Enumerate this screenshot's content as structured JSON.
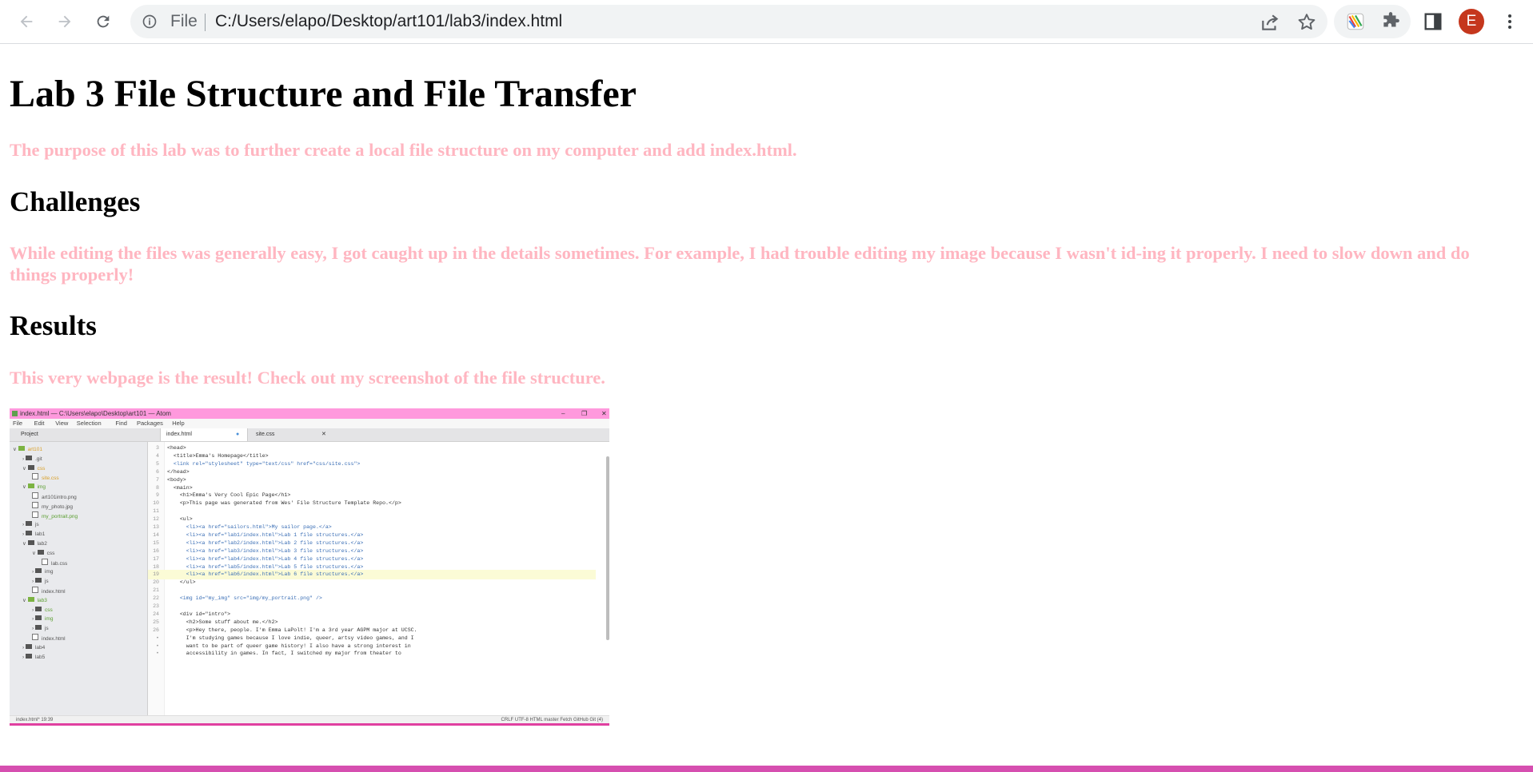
{
  "browser": {
    "file_label": "File",
    "url": "C:/Users/elapo/Desktop/art101/lab3/index.html",
    "avatar_initial": "E"
  },
  "page": {
    "title": "Lab 3 File Structure and File Transfer",
    "intro": "The purpose of this lab was to further create a local file structure on my computer and add index.html.",
    "challenges_heading": "Challenges",
    "challenges_text": "While editing the files was generally easy, I got caught up in the details sometimes. For example, I had trouble editing my image because I wasn't id-ing it properly. I need to slow down and do things properly!",
    "results_heading": "Results",
    "results_text": "This very webpage is the result! Check out my screenshot of the file structure."
  },
  "screenshot": {
    "window_title": "index.html — C:\\Users\\elapo\\Desktop\\art101 — Atom",
    "menu": [
      "File",
      "Edit",
      "View",
      "Selection",
      "Find",
      "Packages",
      "Help"
    ],
    "panel_label": "Project",
    "tabs": [
      "index.html",
      "site.css"
    ],
    "tree": [
      {
        "label": "art101",
        "depth": 0,
        "type": "folder",
        "open": true
      },
      {
        "label": ".git",
        "depth": 1,
        "type": "folder",
        "open": false
      },
      {
        "label": "css",
        "depth": 1,
        "type": "folder",
        "open": true
      },
      {
        "label": "site.css",
        "depth": 2,
        "type": "file"
      },
      {
        "label": "img",
        "depth": 1,
        "type": "folder",
        "open": true
      },
      {
        "label": "art101intro.png",
        "depth": 2,
        "type": "file"
      },
      {
        "label": "my_photo.jpg",
        "depth": 2,
        "type": "file"
      },
      {
        "label": "my_portrait.png",
        "depth": 2,
        "type": "file"
      },
      {
        "label": "js",
        "depth": 1,
        "type": "folder",
        "open": false
      },
      {
        "label": "lab1",
        "depth": 1,
        "type": "folder",
        "open": false
      },
      {
        "label": "lab2",
        "depth": 1,
        "type": "folder",
        "open": true
      },
      {
        "label": "css",
        "depth": 2,
        "type": "folder",
        "open": true
      },
      {
        "label": "lab.css",
        "depth": 3,
        "type": "file"
      },
      {
        "label": "img",
        "depth": 2,
        "type": "folder",
        "open": false
      },
      {
        "label": "js",
        "depth": 2,
        "type": "folder",
        "open": false
      },
      {
        "label": "index.html",
        "depth": 2,
        "type": "file"
      },
      {
        "label": "lab3",
        "depth": 1,
        "type": "folder",
        "open": true
      },
      {
        "label": "css",
        "depth": 2,
        "type": "folder",
        "open": false
      },
      {
        "label": "img",
        "depth": 2,
        "type": "folder",
        "open": false
      },
      {
        "label": "js",
        "depth": 2,
        "type": "folder",
        "open": false
      },
      {
        "label": "index.html",
        "depth": 2,
        "type": "file"
      },
      {
        "label": "lab4",
        "depth": 1,
        "type": "folder",
        "open": false
      },
      {
        "label": "lab5",
        "depth": 1,
        "type": "folder",
        "open": false
      }
    ],
    "code_lines": [
      {
        "n": "3",
        "text": "<head>"
      },
      {
        "n": "4",
        "text": "  <title>Emma's Homepage</title>"
      },
      {
        "n": "5",
        "text": "  <link rel=\"stylesheet\" type=\"text/css\" href=\"css/site.css\">"
      },
      {
        "n": "6",
        "text": "</head>"
      },
      {
        "n": "7",
        "text": "<body>"
      },
      {
        "n": "8",
        "text": "  <main>"
      },
      {
        "n": "9",
        "text": "    <h1>Emma's Very Cool Epic Page</h1>"
      },
      {
        "n": "10",
        "text": "    <p>This page was generated from Wes' File Structure Template Repo.</p>"
      },
      {
        "n": "11",
        "text": ""
      },
      {
        "n": "12",
        "text": "    <ul>"
      },
      {
        "n": "13",
        "text": "      <li><a href=\"sailors.html\">My sailor page.</a>"
      },
      {
        "n": "14",
        "text": "      <li><a href=\"lab1/index.html\">Lab 1 file structures.</a>"
      },
      {
        "n": "15",
        "text": "      <li><a href=\"lab2/index.html\">Lab 2 file structures.</a>"
      },
      {
        "n": "16",
        "text": "      <li><a href=\"lab3/index.html\">Lab 3 file structures.</a>"
      },
      {
        "n": "17",
        "text": "      <li><a href=\"lab4/index.html\">Lab 4 file structures.</a>"
      },
      {
        "n": "18",
        "text": "      <li><a href=\"lab5/index.html\">Lab 5 file structures.</a>"
      },
      {
        "n": "19",
        "text": "      <li><a href=\"lab6/index.html\">Lab 6 file structures.</a>"
      },
      {
        "n": "20",
        "text": "    </ul>"
      },
      {
        "n": "21",
        "text": ""
      },
      {
        "n": "22",
        "text": "    <img id=\"my_img\" src=\"img/my_portrait.png\" />"
      },
      {
        "n": "23",
        "text": ""
      },
      {
        "n": "24",
        "text": "    <div id=\"intro\">"
      },
      {
        "n": "25",
        "text": "      <h2>Some stuff about me.</h2>"
      },
      {
        "n": "26",
        "text": "      <p>Hey there, people. I'm Emma LaPolt! I'm a 3rd year AGPM major at UCSC."
      },
      {
        "n": "•",
        "text": "      I'm studying games because I love indie, queer, artsy video games, and I"
      },
      {
        "n": "•",
        "text": "      want to be part of queer game history! I also have a strong interest in"
      },
      {
        "n": "•",
        "text": "      accessibility in games. In fact, I switched my major from theater to"
      }
    ],
    "status_left": "index.html*  19:39",
    "status_right": "CRLF   UTF-8   HTML   master   Fetch   GitHub   Git (4)"
  }
}
